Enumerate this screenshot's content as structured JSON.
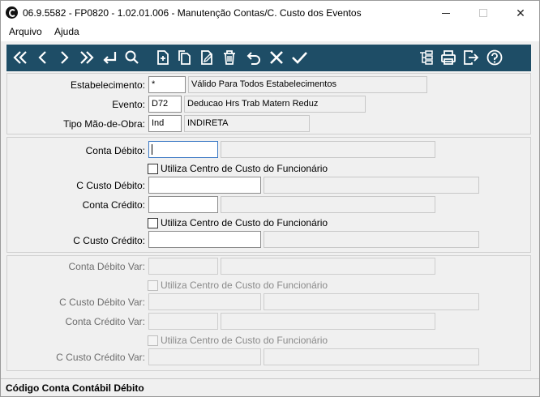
{
  "window": {
    "title": "06.9.5582 - FP0820 - 1.02.01.006 - Manutenção Contas/C. Custo dos Eventos",
    "minimize": "–",
    "close": "✕"
  },
  "menu": {
    "items": [
      "Arquivo",
      "Ajuda"
    ]
  },
  "toolbar": {
    "background": "#1e4d66",
    "icons": [
      "first-icon",
      "prev-icon",
      "next-icon",
      "last-icon",
      "goto-icon",
      "search-icon",
      "new-icon",
      "copy-icon",
      "edit-icon",
      "delete-icon",
      "undo-icon",
      "cancel-icon",
      "confirm-icon",
      "tree-icon",
      "print-icon",
      "exit-icon",
      "help-icon"
    ]
  },
  "header_panel": {
    "estabelecimento": {
      "label": "Estabelecimento:",
      "value": "*",
      "description": "Válido Para Todos Estabelecimentos"
    },
    "evento": {
      "label": "Evento:",
      "value": "D72",
      "description": "Deducao Hrs Trab Matern Reduz"
    },
    "tipo_mao_obra": {
      "label": "Tipo Mão-de-Obra:",
      "value": "Ind",
      "description": "INDIRETA"
    }
  },
  "main_panel": {
    "conta_debito": {
      "label": "Conta Débito:",
      "value": "",
      "description": ""
    },
    "chk_debito": {
      "label": "Utiliza Centro de Custo do Funcionário",
      "checked": false
    },
    "cc_debito": {
      "label": "C Custo Débito:",
      "value": "",
      "description": ""
    },
    "conta_credito": {
      "label": "Conta Crédito:",
      "value": "",
      "description": ""
    },
    "chk_credito": {
      "label": "Utiliza Centro de Custo do Funcionário",
      "checked": false
    },
    "cc_credito": {
      "label": "C Custo Crédito:",
      "value": "",
      "description": ""
    }
  },
  "var_panel": {
    "conta_debito_var": {
      "label": "Conta Débito Var:",
      "value": "",
      "description": ""
    },
    "chk_debito_var": {
      "label": "Utiliza Centro de Custo do Funcionário",
      "checked": false
    },
    "cc_debito_var": {
      "label": "C Custo Débito Var:",
      "value": "",
      "description": ""
    },
    "conta_credito_var": {
      "label": "Conta Crédito Var:",
      "value": "",
      "description": ""
    },
    "chk_credito_var": {
      "label": "Utiliza Centro de Custo do Funcionário",
      "checked": false
    },
    "cc_credito_var": {
      "label": "C Custo Crédito Var:",
      "value": "",
      "description": ""
    }
  },
  "status": {
    "text": "Código Conta Contábil Débito"
  }
}
